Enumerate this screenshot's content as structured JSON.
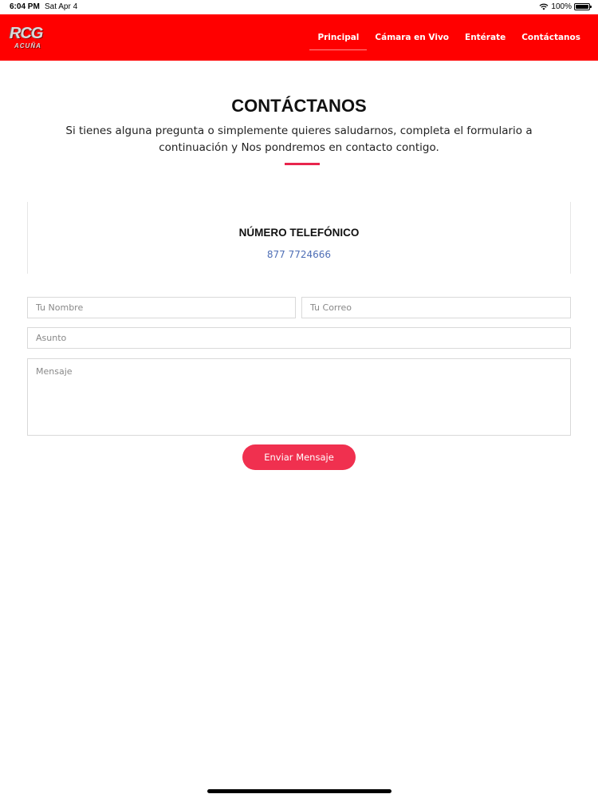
{
  "status_bar": {
    "time": "6:04 PM",
    "date": "Sat Apr 4",
    "battery": "100%",
    "wifi_icon": "wifi-icon",
    "battery_icon": "battery-icon"
  },
  "header": {
    "logo_text": "RCG",
    "logo_subtext": "ACUÑA",
    "nav": [
      {
        "label": "Principal",
        "active": true
      },
      {
        "label": "Cámara en Vivo",
        "active": false
      },
      {
        "label": "Entérate",
        "active": false
      },
      {
        "label": "Contáctanos",
        "active": false
      }
    ],
    "background_color": "#ff0000"
  },
  "contact": {
    "title": "CONTÁCTANOS",
    "description": "Si tienes alguna pregunta o simplemente quieres saludarnos, completa el formulario a continuación y Nos pondremos en contacto contigo.",
    "accent_color": "#e8254d"
  },
  "info": {
    "phone_title": "NÚMERO TELEFÓNICO",
    "phone_number": "877 7724666",
    "link_color": "#4f6fb6"
  },
  "form": {
    "name_placeholder": "Tu Nombre",
    "email_placeholder": "Tu Correo",
    "subject_placeholder": "Asunto",
    "message_placeholder": "Mensaje",
    "submit_label": "Enviar Mensaje",
    "button_color": "#f0304f"
  }
}
